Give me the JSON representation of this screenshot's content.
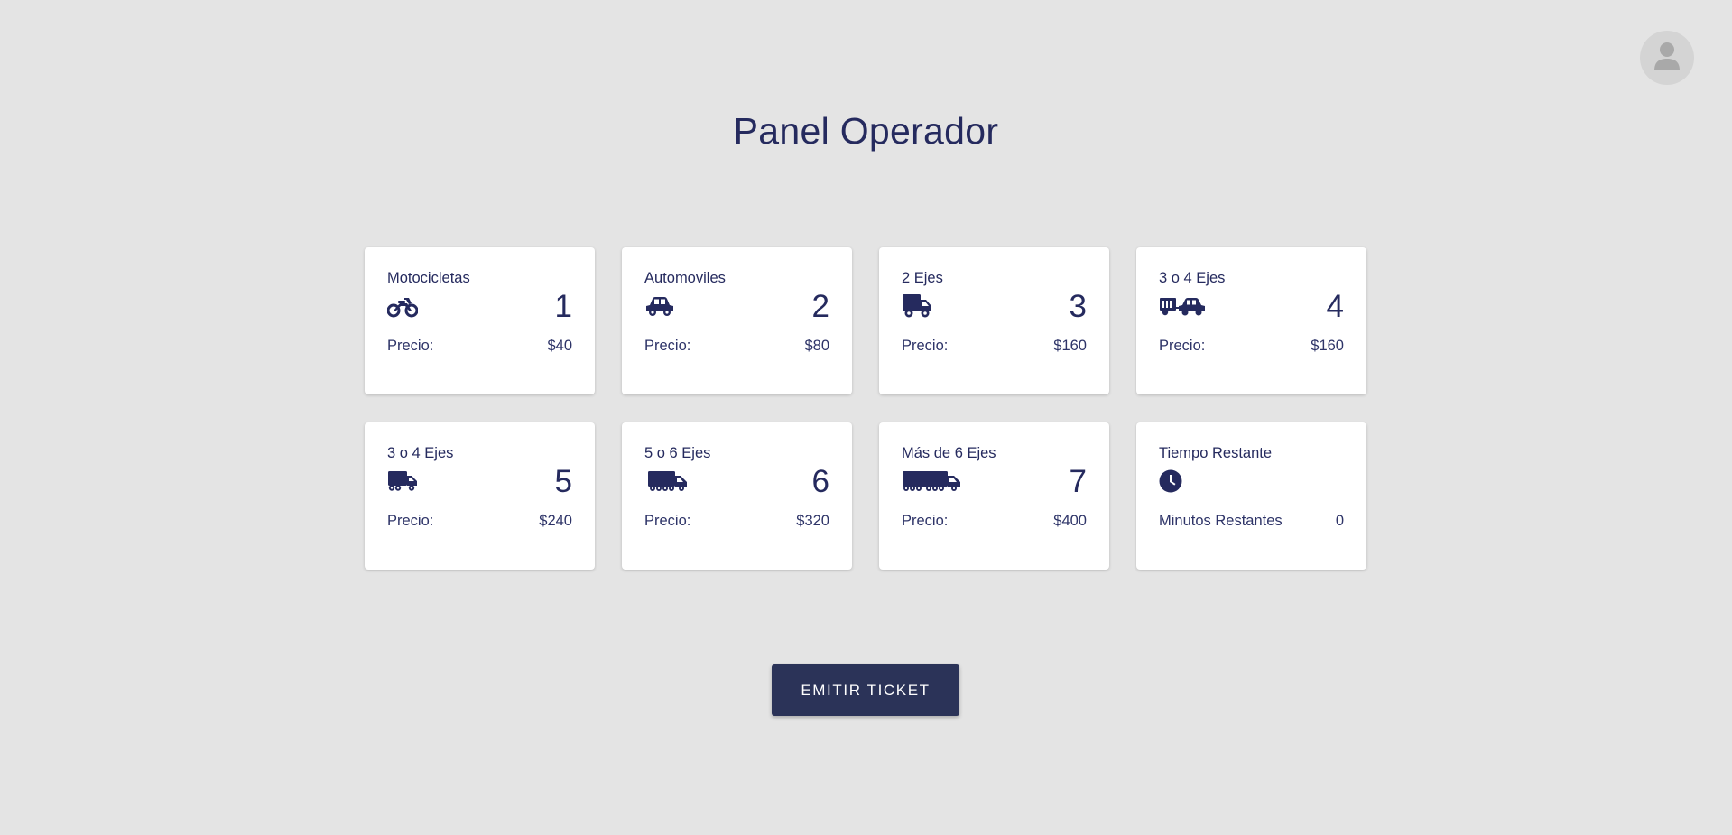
{
  "header": {
    "title": "Panel Operador",
    "avatar_icon": "user-icon"
  },
  "cards": [
    {
      "title": "Motocicletas",
      "icon": "motorcycle-icon",
      "number": "1",
      "label": "Precio:",
      "value": "$40"
    },
    {
      "title": "Automoviles",
      "icon": "car-icon",
      "number": "2",
      "label": "Precio:",
      "value": "$80"
    },
    {
      "title": "2 Ejes",
      "icon": "truck-icon",
      "number": "3",
      "label": "Precio:",
      "value": "$160"
    },
    {
      "title": "3 o 4 Ejes",
      "icon": "car-with-trailer-icon",
      "number": "4",
      "label": "Precio:",
      "value": "$160"
    },
    {
      "title": "3 o 4 Ejes",
      "icon": "truck-icon",
      "number": "5",
      "label": "Precio:",
      "value": "$240"
    },
    {
      "title": "5 o 6 Ejes",
      "icon": "truck-6-wheels-icon",
      "number": "6",
      "label": "Precio:",
      "value": "$320"
    },
    {
      "title": "Más de 6 Ejes",
      "icon": "long-truck-icon",
      "number": "7",
      "label": "Precio:",
      "value": "$400"
    },
    {
      "title": "Tiempo Restante",
      "icon": "clock-icon",
      "number": "",
      "label": "Minutos Restantes",
      "value": "0"
    }
  ],
  "actions": {
    "emit_label": "EMITIR TICKET"
  },
  "colors": {
    "background": "#e4e4e4",
    "primary_text": "#252a5e",
    "button": "#2b3358",
    "card": "#ffffff"
  }
}
